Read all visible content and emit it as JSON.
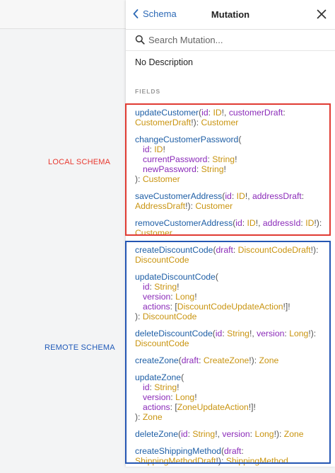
{
  "annotations": {
    "local_label": "LOCAL SCHEMA",
    "remote_label": "REMOTE SCHEMA",
    "local_color": "#e03b33",
    "remote_color": "#2456b3"
  },
  "header": {
    "back_label": "Schema",
    "title": "Mutation",
    "back_icon": "chevron-left-icon",
    "close_icon": "close-icon"
  },
  "search": {
    "placeholder": "Search Mutation...",
    "value": "",
    "icon": "search-icon"
  },
  "description": "No Description",
  "fields_heading": "FIELDS",
  "syntax_colors": {
    "field": "#1f5fa6",
    "argument": "#8b2bb9",
    "type": "#c99410",
    "punctuation": "#555555"
  },
  "fields": [
    {
      "lines": [
        [
          {
            "t": "updateCustomer",
            "c": "fn"
          },
          {
            "t": "(",
            "c": "pun"
          },
          {
            "t": "id",
            "c": "arg"
          },
          {
            "t": ": ",
            "c": "pun"
          },
          {
            "t": "ID",
            "c": "typ"
          },
          {
            "t": "!, ",
            "c": "pun"
          },
          {
            "t": "customerDraft",
            "c": "arg"
          },
          {
            "t": ":",
            "c": "pun"
          }
        ],
        [
          {
            "t": "CustomerDraft",
            "c": "typ"
          },
          {
            "t": "!): ",
            "c": "pun"
          },
          {
            "t": "Customer",
            "c": "typ"
          }
        ]
      ]
    },
    {
      "lines": [
        [
          {
            "t": "changeCustomerPassword",
            "c": "fn"
          },
          {
            "t": "(",
            "c": "pun"
          }
        ],
        [
          {
            "t": "id",
            "c": "arg",
            "i": 1
          },
          {
            "t": ": ",
            "c": "pun"
          },
          {
            "t": "ID",
            "c": "typ"
          },
          {
            "t": "!",
            "c": "pun"
          }
        ],
        [
          {
            "t": "currentPassword",
            "c": "arg",
            "i": 1
          },
          {
            "t": ": ",
            "c": "pun"
          },
          {
            "t": "String",
            "c": "typ"
          },
          {
            "t": "!",
            "c": "pun"
          }
        ],
        [
          {
            "t": "newPassword",
            "c": "arg",
            "i": 1
          },
          {
            "t": ": ",
            "c": "pun"
          },
          {
            "t": "String",
            "c": "typ"
          },
          {
            "t": "!",
            "c": "pun"
          }
        ],
        [
          {
            "t": "): ",
            "c": "pun"
          },
          {
            "t": "Customer",
            "c": "typ"
          }
        ]
      ]
    },
    {
      "lines": [
        [
          {
            "t": "saveCustomerAddress",
            "c": "fn"
          },
          {
            "t": "(",
            "c": "pun"
          },
          {
            "t": "id",
            "c": "arg"
          },
          {
            "t": ": ",
            "c": "pun"
          },
          {
            "t": "ID",
            "c": "typ"
          },
          {
            "t": "!, ",
            "c": "pun"
          },
          {
            "t": "addressDraft",
            "c": "arg"
          },
          {
            "t": ":",
            "c": "pun"
          }
        ],
        [
          {
            "t": "AddressDraft",
            "c": "typ"
          },
          {
            "t": "!): ",
            "c": "pun"
          },
          {
            "t": "Customer",
            "c": "typ"
          }
        ]
      ]
    },
    {
      "lines": [
        [
          {
            "t": "removeCustomerAddress",
            "c": "fn"
          },
          {
            "t": "(",
            "c": "pun"
          },
          {
            "t": "id",
            "c": "arg"
          },
          {
            "t": ": ",
            "c": "pun"
          },
          {
            "t": "ID",
            "c": "typ"
          },
          {
            "t": "!, ",
            "c": "pun"
          },
          {
            "t": "addressId",
            "c": "arg"
          },
          {
            "t": ": ",
            "c": "pun"
          },
          {
            "t": "ID",
            "c": "typ"
          },
          {
            "t": "!):",
            "c": "pun"
          }
        ],
        [
          {
            "t": "Customer",
            "c": "typ"
          }
        ]
      ]
    },
    {
      "lines": [
        [
          {
            "t": "createDiscountCode",
            "c": "fn"
          },
          {
            "t": "(",
            "c": "pun"
          },
          {
            "t": "draft",
            "c": "arg"
          },
          {
            "t": ": ",
            "c": "pun"
          },
          {
            "t": "DiscountCodeDraft",
            "c": "typ"
          },
          {
            "t": "!):",
            "c": "pun"
          }
        ],
        [
          {
            "t": "DiscountCode",
            "c": "typ"
          }
        ]
      ]
    },
    {
      "lines": [
        [
          {
            "t": "updateDiscountCode",
            "c": "fn"
          },
          {
            "t": "(",
            "c": "pun"
          }
        ],
        [
          {
            "t": "id",
            "c": "arg",
            "i": 1
          },
          {
            "t": ": ",
            "c": "pun"
          },
          {
            "t": "String",
            "c": "typ"
          },
          {
            "t": "!",
            "c": "pun"
          }
        ],
        [
          {
            "t": "version",
            "c": "arg",
            "i": 1
          },
          {
            "t": ": ",
            "c": "pun"
          },
          {
            "t": "Long",
            "c": "typ"
          },
          {
            "t": "!",
            "c": "pun"
          }
        ],
        [
          {
            "t": "actions",
            "c": "arg",
            "i": 1
          },
          {
            "t": ": [",
            "c": "pun"
          },
          {
            "t": "DiscountCodeUpdateAction",
            "c": "typ"
          },
          {
            "t": "!]!",
            "c": "pun"
          }
        ],
        [
          {
            "t": "): ",
            "c": "pun"
          },
          {
            "t": "DiscountCode",
            "c": "typ"
          }
        ]
      ]
    },
    {
      "lines": [
        [
          {
            "t": "deleteDiscountCode",
            "c": "fn"
          },
          {
            "t": "(",
            "c": "pun"
          },
          {
            "t": "id",
            "c": "arg"
          },
          {
            "t": ": ",
            "c": "pun"
          },
          {
            "t": "String",
            "c": "typ"
          },
          {
            "t": "!, ",
            "c": "pun"
          },
          {
            "t": "version",
            "c": "arg"
          },
          {
            "t": ": ",
            "c": "pun"
          },
          {
            "t": "Long",
            "c": "typ"
          },
          {
            "t": "!):",
            "c": "pun"
          }
        ],
        [
          {
            "t": "DiscountCode",
            "c": "typ"
          }
        ]
      ]
    },
    {
      "lines": [
        [
          {
            "t": "createZone",
            "c": "fn"
          },
          {
            "t": "(",
            "c": "pun"
          },
          {
            "t": "draft",
            "c": "arg"
          },
          {
            "t": ": ",
            "c": "pun"
          },
          {
            "t": "CreateZone",
            "c": "typ"
          },
          {
            "t": "!): ",
            "c": "pun"
          },
          {
            "t": "Zone",
            "c": "typ"
          }
        ]
      ]
    },
    {
      "lines": [
        [
          {
            "t": "updateZone",
            "c": "fn"
          },
          {
            "t": "(",
            "c": "pun"
          }
        ],
        [
          {
            "t": "id",
            "c": "arg",
            "i": 1
          },
          {
            "t": ": ",
            "c": "pun"
          },
          {
            "t": "String",
            "c": "typ"
          },
          {
            "t": "!",
            "c": "pun"
          }
        ],
        [
          {
            "t": "version",
            "c": "arg",
            "i": 1
          },
          {
            "t": ": ",
            "c": "pun"
          },
          {
            "t": "Long",
            "c": "typ"
          },
          {
            "t": "!",
            "c": "pun"
          }
        ],
        [
          {
            "t": "actions",
            "c": "arg",
            "i": 1
          },
          {
            "t": ": [",
            "c": "pun"
          },
          {
            "t": "ZoneUpdateAction",
            "c": "typ"
          },
          {
            "t": "!]!",
            "c": "pun"
          }
        ],
        [
          {
            "t": "): ",
            "c": "pun"
          },
          {
            "t": "Zone",
            "c": "typ"
          }
        ]
      ]
    },
    {
      "lines": [
        [
          {
            "t": "deleteZone",
            "c": "fn"
          },
          {
            "t": "(",
            "c": "pun"
          },
          {
            "t": "id",
            "c": "arg"
          },
          {
            "t": ": ",
            "c": "pun"
          },
          {
            "t": "String",
            "c": "typ"
          },
          {
            "t": "!, ",
            "c": "pun"
          },
          {
            "t": "version",
            "c": "arg"
          },
          {
            "t": ": ",
            "c": "pun"
          },
          {
            "t": "Long",
            "c": "typ"
          },
          {
            "t": "!): ",
            "c": "pun"
          },
          {
            "t": "Zone",
            "c": "typ"
          }
        ]
      ]
    },
    {
      "lines": [
        [
          {
            "t": "createShippingMethod",
            "c": "fn"
          },
          {
            "t": "(",
            "c": "pun"
          },
          {
            "t": "draft",
            "c": "arg"
          },
          {
            "t": ":",
            "c": "pun"
          }
        ],
        [
          {
            "t": "ShippingMethodDraft",
            "c": "typ"
          },
          {
            "t": "!): ",
            "c": "pun"
          },
          {
            "t": "ShippingMethod",
            "c": "typ"
          }
        ]
      ]
    }
  ]
}
